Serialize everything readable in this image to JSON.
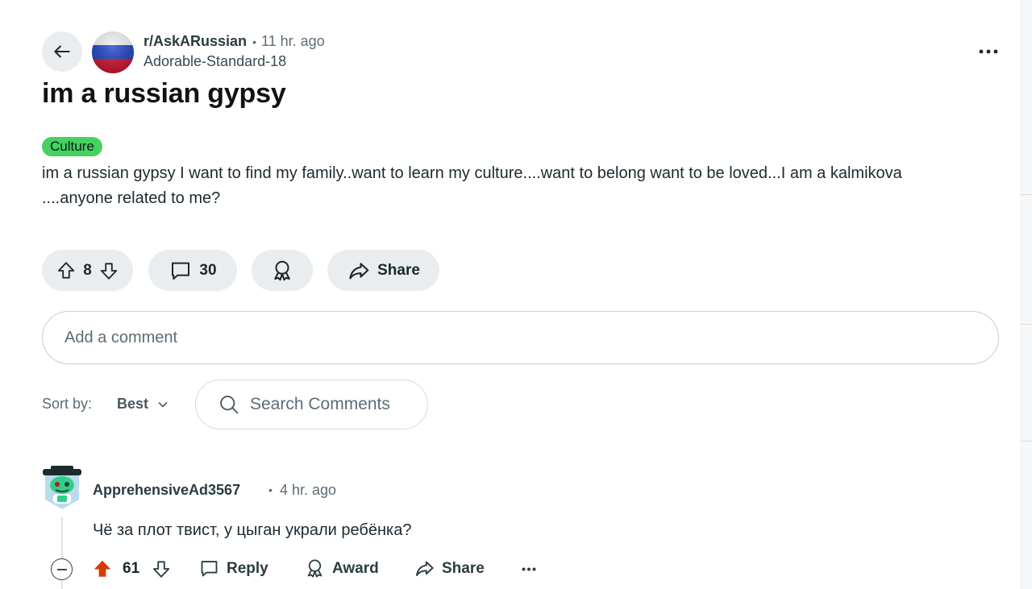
{
  "post": {
    "subreddit": "r/AskARussian",
    "time": "11 hr. ago",
    "author": "Adorable-Standard-18",
    "title": "im a russian gypsy",
    "flair": "Culture",
    "flair_color": "#46d160",
    "body": "im a russian gypsy I want to find my family..want to learn my culture....want to belong want to be loved...I am a kalmikova ....anyone related to me?",
    "score": "8",
    "comments_count": "30",
    "share_label": "Share"
  },
  "comment_input": {
    "placeholder": "Add a comment"
  },
  "sort": {
    "label": "Sort by:",
    "value": "Best"
  },
  "search": {
    "placeholder": "Search Comments"
  },
  "comment": {
    "author": "ApprehensiveAd3567",
    "time": "4 hr. ago",
    "body": "Чё за плот твист, у цыган украли ребёнка?",
    "score": "61",
    "reply_label": "Reply",
    "award_label": "Award",
    "share_label": "Share",
    "upvoted_color": "#d93a00"
  },
  "icons": [
    "back-arrow-icon",
    "more-horizontal-icon",
    "upvote-icon",
    "downvote-icon",
    "comment-icon",
    "award-icon",
    "share-icon",
    "search-icon",
    "chevron-down-icon",
    "collapse-icon"
  ]
}
